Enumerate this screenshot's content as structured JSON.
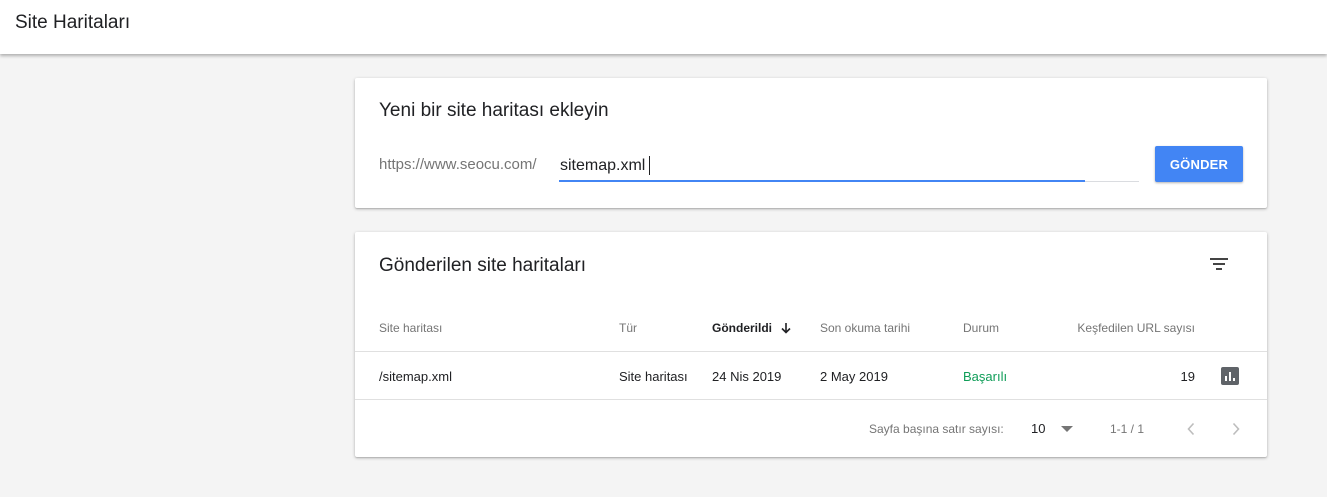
{
  "header": {
    "title": "Site Haritaları"
  },
  "add_card": {
    "heading": "Yeni bir site haritası ekleyin",
    "url_prefix": "https://www.seocu.com/",
    "input_value": "sitemap.xml",
    "submit_label": "GÖNDER"
  },
  "list_card": {
    "heading": "Gönderilen site haritaları",
    "columns": {
      "sitemap": "Site haritası",
      "type": "Tür",
      "submitted": "Gönderildi",
      "last_read": "Son okuma tarihi",
      "status": "Durum",
      "discovered": "Keşfedilen URL sayısı"
    },
    "rows": [
      {
        "sitemap": "/sitemap.xml",
        "type": "Site haritası",
        "submitted": "24 Nis 2019",
        "last_read": "2 May 2019",
        "status": "Başarılı",
        "discovered": "19"
      }
    ],
    "pagination": {
      "rows_per_page_label": "Sayfa başına satır sayısı:",
      "rows_per_page_value": "10",
      "range": "1-1 / 1"
    }
  },
  "colors": {
    "accent": "#4285f4",
    "success": "#0f9d58",
    "background": "#f4f4f4"
  },
  "icons": {
    "sort": "arrow-down-icon",
    "filter": "filter-icon",
    "row_action": "bar-chart-icon",
    "dropdown": "caret-down-icon",
    "prev": "chevron-left-icon",
    "next": "chevron-right-icon"
  }
}
